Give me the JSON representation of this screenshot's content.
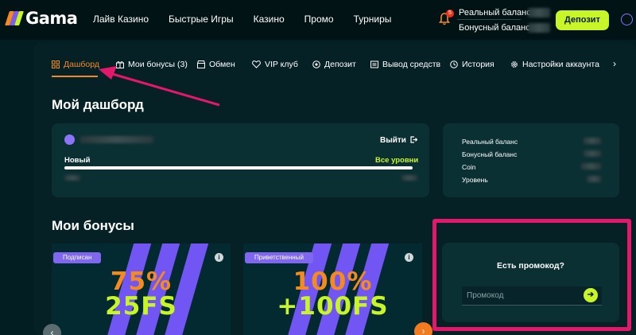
{
  "header": {
    "logo": "Gama",
    "nav": [
      "Лайв Казино",
      "Быстрые Игры",
      "Казино",
      "Промо",
      "Турниры"
    ],
    "notifications_count": "5",
    "real_balance_label": "Реальный баланс",
    "bonus_balance_label": "Бонусный баланс",
    "deposit_label": "Депозит"
  },
  "tabs": [
    {
      "label": "Дашборд",
      "icon": "dashboard-icon",
      "active": true
    },
    {
      "label": "Мои бонусы (3)",
      "icon": "gift-icon"
    },
    {
      "label": "Обмен",
      "icon": "shop-icon"
    },
    {
      "label": "VIP клуб",
      "icon": "heart-icon"
    },
    {
      "label": "Депозит",
      "icon": "coin-icon"
    },
    {
      "label": "Вывод средств",
      "icon": "wallet-icon"
    },
    {
      "label": "История",
      "icon": "clock-icon"
    },
    {
      "label": "Настройки аккаунта",
      "icon": "gear-icon"
    }
  ],
  "dashboard": {
    "title": "Мой дашборд",
    "logout_label": "Выйти",
    "level_label": "Новый",
    "all_levels_label": "Все уровни",
    "progress": 1.0
  },
  "balance_card": {
    "rows": [
      "Реальный баланс",
      "Бонусный баланс",
      "Coin",
      "Уровень"
    ]
  },
  "bonuses": {
    "title": "Мои бонусы",
    "cards": [
      {
        "tag": "Подписан",
        "line1": "75%",
        "line2": "25FS"
      },
      {
        "tag": "Приветственный",
        "line1": "100%",
        "line2": "+100FS"
      }
    ]
  },
  "promo": {
    "title": "Есть промокод?",
    "placeholder": "Промокод"
  },
  "colors": {
    "accent_lime": "#c7f528",
    "accent_orange": "#f28922",
    "bonus_purple": "#7256f3",
    "highlight_pink": "#e2186d"
  }
}
